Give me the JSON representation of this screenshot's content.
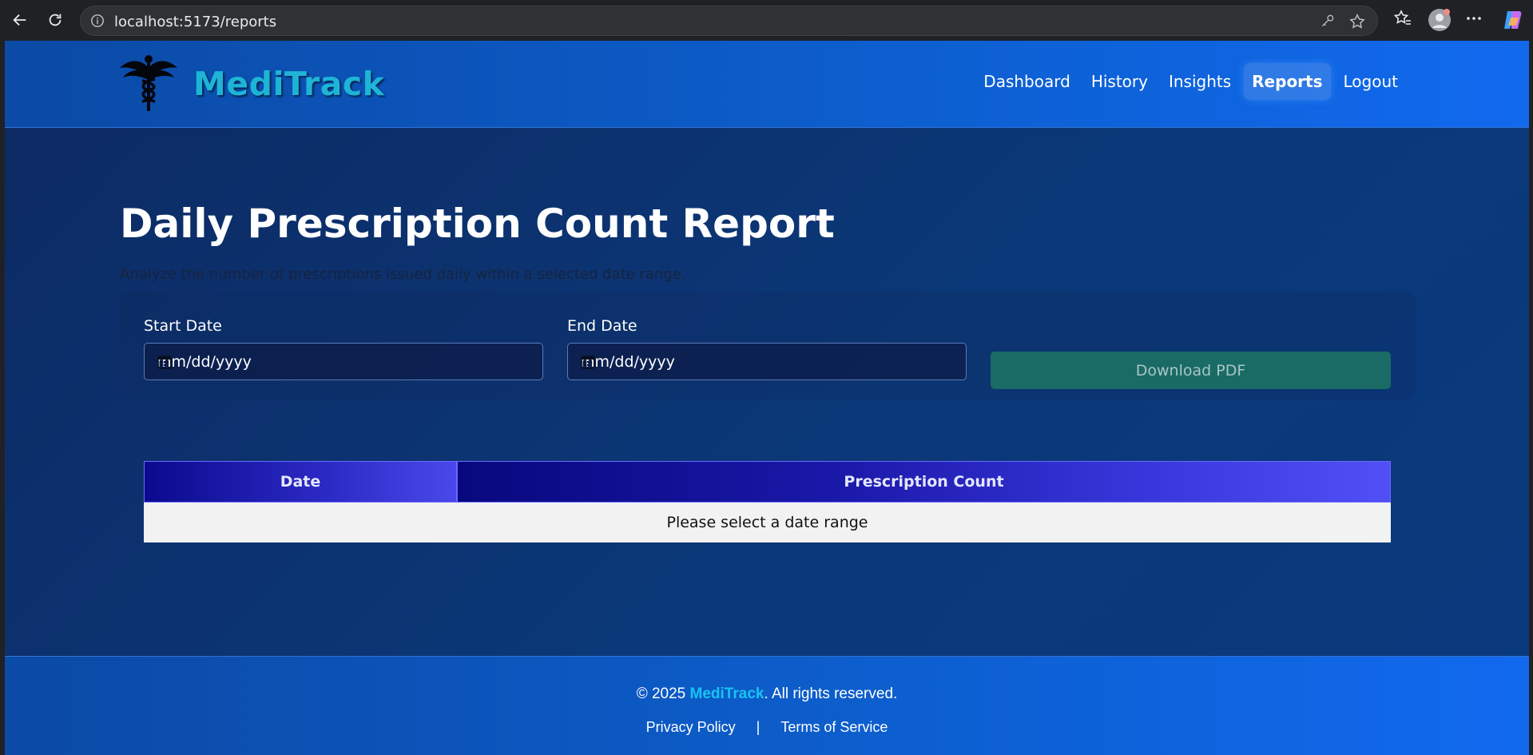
{
  "browser": {
    "url": "localhost:5173/reports"
  },
  "header": {
    "brand": "MediTrack",
    "nav": [
      {
        "label": "Dashboard",
        "active": false
      },
      {
        "label": "History",
        "active": false
      },
      {
        "label": "Insights",
        "active": false
      },
      {
        "label": "Reports",
        "active": true
      },
      {
        "label": "Logout",
        "active": false
      }
    ]
  },
  "main": {
    "title": "Daily Prescription Count Report",
    "subtitle": "Analyze the number of prescriptions issued daily within a selected date range.",
    "start_date": {
      "label": "Start Date",
      "placeholder": "mm/dd/yyyy"
    },
    "end_date": {
      "label": "End Date",
      "placeholder": "mm/dd/yyyy"
    },
    "download_label": "Download PDF",
    "table": {
      "columns": [
        "Date",
        "Prescription Count"
      ],
      "empty_message": "Please select a date range"
    }
  },
  "footer": {
    "copyright_prefix": "© 2025 ",
    "brand": "MediTrack",
    "copyright_suffix": ". All rights reserved.",
    "privacy": "Privacy Policy",
    "separator": "|",
    "terms": "Terms of Service"
  },
  "colors": {
    "header_blue": "#0d5fd0",
    "page_bg": "#0b3878",
    "brand_cyan": "#1eb4d6",
    "download_button": "#1a6b65",
    "table_header": "#2d2bc6"
  }
}
